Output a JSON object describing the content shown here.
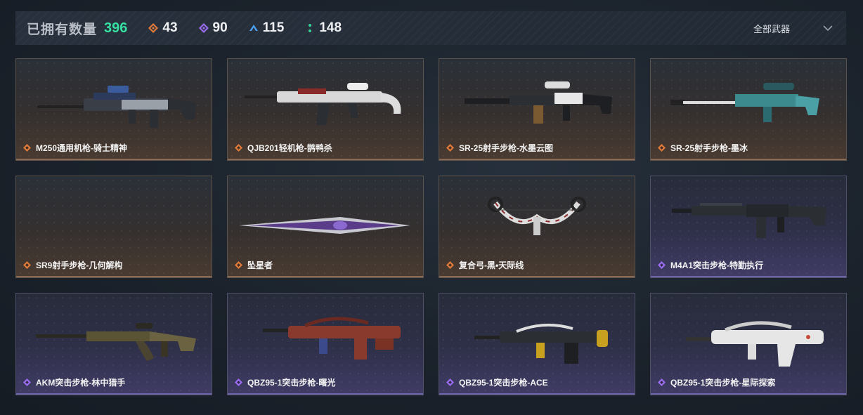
{
  "header": {
    "owned_label": "已拥有数量",
    "owned_count": "396",
    "stats": [
      {
        "icon": "orange-diamond-icon",
        "value": "43",
        "color": "#e07a3a"
      },
      {
        "icon": "purple-diamond-icon",
        "value": "90",
        "color": "#9a6df0"
      },
      {
        "icon": "blue-chevron-icon",
        "value": "115",
        "color": "#4aa0f0"
      },
      {
        "icon": "green-dots-icon",
        "value": "148",
        "color": "#35d49a"
      }
    ],
    "filter_label": "全部武器"
  },
  "weapons": [
    {
      "name": "M250通用机枪-骑士精神",
      "rarity": "orange"
    },
    {
      "name": "QJB201轻机枪-鹊鸭杀",
      "rarity": "orange"
    },
    {
      "name": "SR-25射手步枪-水墨云图",
      "rarity": "orange"
    },
    {
      "name": "SR-25射手步枪-墨冰",
      "rarity": "orange"
    },
    {
      "name": "SR9射手步枪-几何解构",
      "rarity": "orange"
    },
    {
      "name": "坠星者",
      "rarity": "orange"
    },
    {
      "name": "复合弓-黑•天际线",
      "rarity": "orange"
    },
    {
      "name": "M4A1突击步枪-特勤执行",
      "rarity": "purple"
    },
    {
      "name": "AKM突击步枪-林中猎手",
      "rarity": "purple"
    },
    {
      "name": "QBZ95-1突击步枪-曙光",
      "rarity": "purple"
    },
    {
      "name": "QBZ95-1突击步枪-ACE",
      "rarity": "purple"
    },
    {
      "name": "QBZ95-1突击步枪-星际探索",
      "rarity": "purple"
    }
  ]
}
